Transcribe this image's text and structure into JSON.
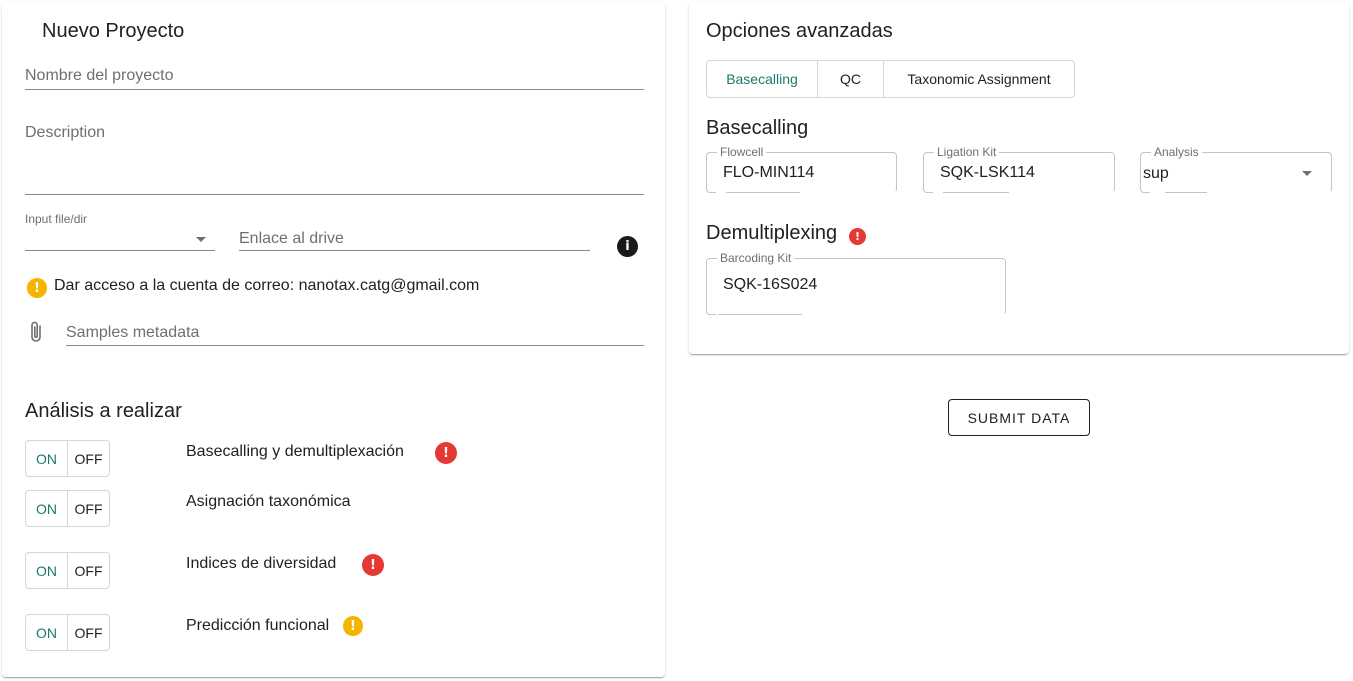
{
  "new_project": {
    "title": "Nuevo Proyecto",
    "name_placeholder": "Nombre del proyecto",
    "description_placeholder": "Description",
    "input_file_label": "Input file/dir",
    "drive_link_placeholder": "Enlace al drive",
    "access_notice": "Dar acceso a la cuenta de correo: nanotax.catg@gmail.com",
    "metadata_placeholder": "Samples metadata"
  },
  "analysis": {
    "title": "Análisis a realizar",
    "items": [
      {
        "label": "Basecalling y demultiplexación",
        "on": "ON",
        "off": "OFF",
        "status": "error"
      },
      {
        "label": "Asignación taxonómica",
        "on": "ON",
        "off": "OFF",
        "status": "none"
      },
      {
        "label": "Indices de diversidad",
        "on": "ON",
        "off": "OFF",
        "status": "error"
      },
      {
        "label": "Predicción funcional",
        "on": "ON",
        "off": "OFF",
        "status": "warning"
      }
    ]
  },
  "advanced": {
    "title": "Opciones avanzadas",
    "tabs": [
      "Basecalling",
      "QC",
      "Taxonomic Assignment"
    ],
    "active_tab": "Basecalling",
    "basecalling_heading": "Basecalling",
    "flowcell": {
      "label": "Flowcell",
      "value": "FLO-MIN114"
    },
    "ligation_kit": {
      "label": "Ligation Kit",
      "value": "SQK-LSK114"
    },
    "analysis_select": {
      "label": "Analysis",
      "value": "sup"
    },
    "demux_heading": "Demultiplexing",
    "barcoding_kit": {
      "label": "Barcoding Kit",
      "value": "SQK-16S024"
    }
  },
  "submit_label": "SUBMIT DATA",
  "colors": {
    "accent": "#1b7a6b",
    "error": "#e53935",
    "warning": "#f5b400"
  },
  "icons": {
    "info": "info-icon",
    "warning": "warning-icon",
    "error": "error-icon",
    "attach": "paperclip-icon",
    "dropdown": "caret-down-icon"
  }
}
